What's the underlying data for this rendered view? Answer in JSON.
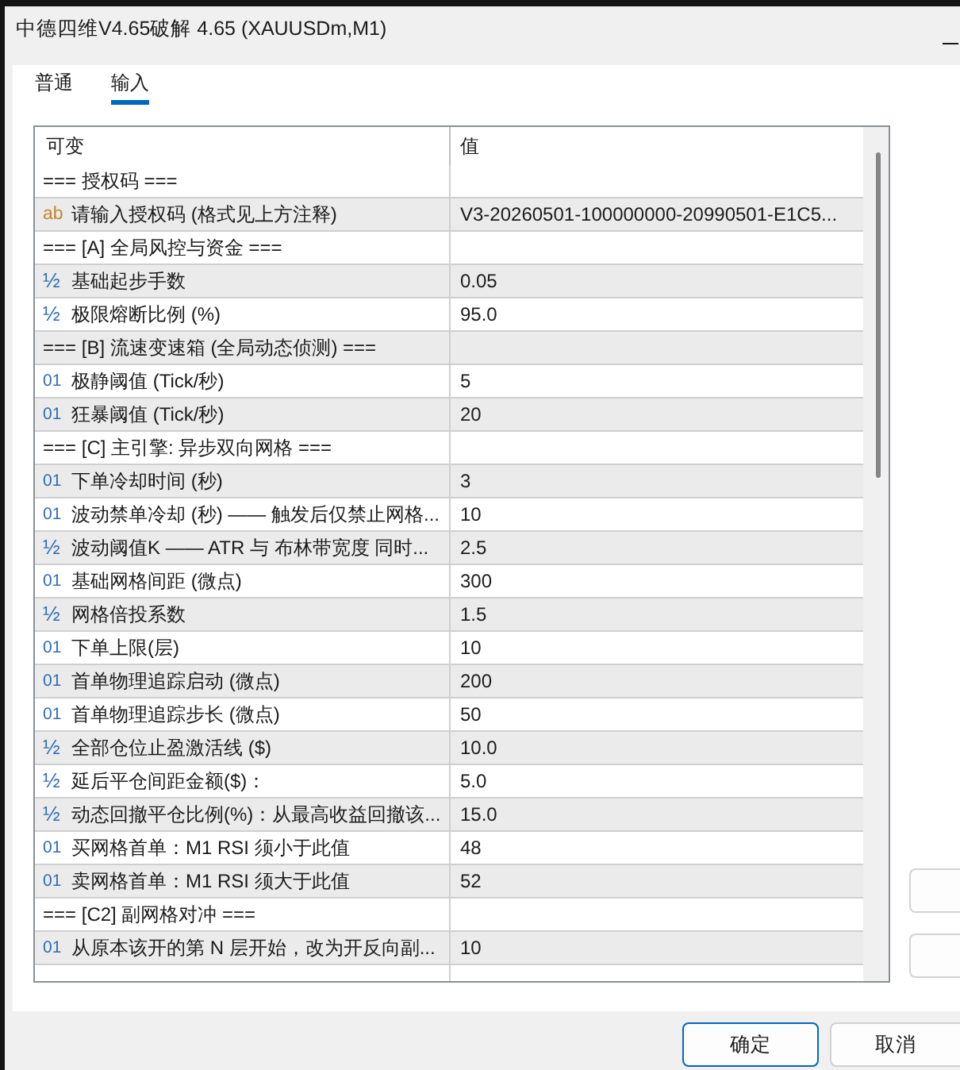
{
  "window": {
    "title": "中德四维V4.65破解 4.65 (XAUUSDm,M1)"
  },
  "tabs": [
    {
      "label": "普通",
      "selected": false
    },
    {
      "label": "输入",
      "selected": true
    }
  ],
  "table": {
    "columns": [
      "可变",
      "值"
    ],
    "rows": [
      {
        "kind": "section",
        "name": "=== 授权码 ==="
      },
      {
        "kind": "string",
        "icon": "ab",
        "name": "请输入授权码 (格式见上方注释)",
        "value": "V3-20260501-100000000-20990501-E1C5..."
      },
      {
        "kind": "section",
        "name": "=== [A] 全局风控与资金 ==="
      },
      {
        "kind": "double",
        "icon": "½",
        "name": "基础起步手数",
        "value": "0.05"
      },
      {
        "kind": "double",
        "icon": "½",
        "name": "极限熔断比例 (%)",
        "value": "95.0"
      },
      {
        "kind": "section",
        "name": "=== [B] 流速变速箱 (全局动态侦测) ==="
      },
      {
        "kind": "int",
        "icon": "01",
        "name": "极静阈值 (Tick/秒)",
        "value": "5"
      },
      {
        "kind": "int",
        "icon": "01",
        "name": "狂暴阈值 (Tick/秒)",
        "value": "20"
      },
      {
        "kind": "section",
        "name": "=== [C] 主引擎: 异步双向网格 ==="
      },
      {
        "kind": "int",
        "icon": "01",
        "name": "下单冷却时间 (秒)",
        "value": "3"
      },
      {
        "kind": "int",
        "icon": "01",
        "name": "波动禁单冷却 (秒) —— 触发后仅禁止网格...",
        "value": "10"
      },
      {
        "kind": "double",
        "icon": "½",
        "name": "波动阈值K —— ATR 与 布林带宽度 同时...",
        "value": "2.5"
      },
      {
        "kind": "int",
        "icon": "01",
        "name": "基础网格间距 (微点)",
        "value": "300"
      },
      {
        "kind": "double",
        "icon": "½",
        "name": "网格倍投系数",
        "value": "1.5"
      },
      {
        "kind": "int",
        "icon": "01",
        "name": "下单上限(层)",
        "value": "10"
      },
      {
        "kind": "int",
        "icon": "01",
        "name": "首单物理追踪启动 (微点)",
        "value": "200"
      },
      {
        "kind": "int",
        "icon": "01",
        "name": "首单物理追踪步长 (微点)",
        "value": "50"
      },
      {
        "kind": "double",
        "icon": "½",
        "name": "全部仓位止盈激活线 ($)",
        "value": "10.0"
      },
      {
        "kind": "double",
        "icon": "½",
        "name": "延后平仓间距金额($)：",
        "value": "5.0"
      },
      {
        "kind": "double",
        "icon": "½",
        "name": "动态回撤平仓比例(%)：从最高收益回撤该...",
        "value": "15.0"
      },
      {
        "kind": "int",
        "icon": "01",
        "name": "买网格首单：M1 RSI 须小于此值",
        "value": "48"
      },
      {
        "kind": "int",
        "icon": "01",
        "name": "卖网格首单：M1 RSI 须大于此值",
        "value": "52"
      },
      {
        "kind": "section",
        "name": "=== [C2] 副网格对冲 ==="
      },
      {
        "kind": "int",
        "icon": "01",
        "name": "从原本该开的第 N 层开始，改为开反向副...",
        "value": "10"
      }
    ]
  },
  "buttons": [
    {
      "label": "确定",
      "default": true
    },
    {
      "label": "取消",
      "default": false
    }
  ]
}
